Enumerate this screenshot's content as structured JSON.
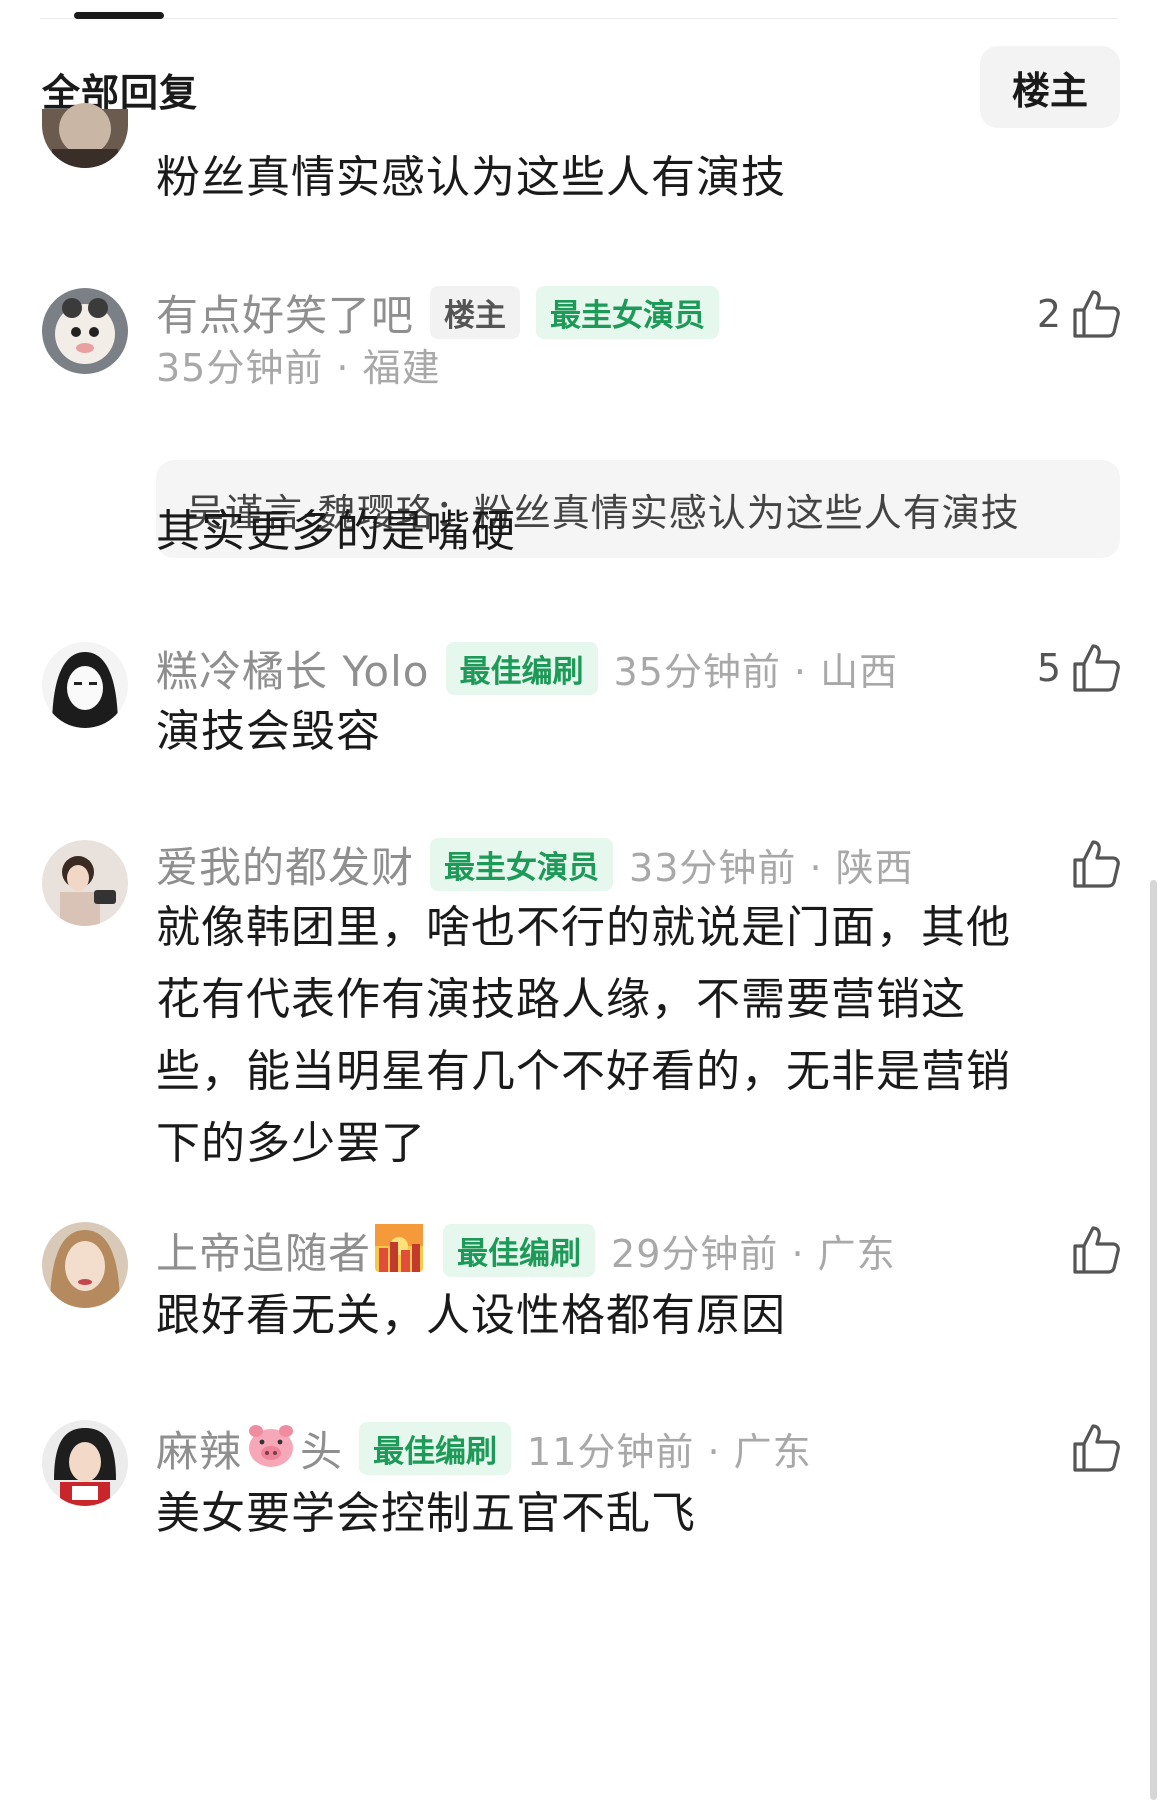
{
  "header": {
    "title": "全部回复",
    "op_filter_label": "楼主"
  },
  "comments": [
    {
      "text": "粉丝真情实感认为这些人有演技"
    },
    {
      "username": "有点好笑了吧",
      "badges": [
        "楼主",
        "最圭女演员"
      ],
      "time_location": "35分钟前 · 福建",
      "likes": "2",
      "quote": "吴谨言-魏璎珞：粉丝真情实感认为这些人有演技",
      "text": "其实更多的是嘴硬"
    },
    {
      "username": "糕冷橘长 Yolo",
      "badges": [
        "最佳编刷"
      ],
      "time_location": "35分钟前 · 山西",
      "likes": "5",
      "text": "演技会毁容"
    },
    {
      "username": "爱我的都发财",
      "badges": [
        "最圭女演员"
      ],
      "time_location": "33分钟前 · 陕西",
      "likes": "",
      "text_lines": [
        "就像韩团里，啥也不行的就说是门面，其他",
        "花有代表作有演技路人缘，不需要营销这",
        "些，能当明星有几个不好看的，无非是营销",
        "下的多少罢了"
      ]
    },
    {
      "username": "上帝追随者",
      "badges": [
        "最佳编刷"
      ],
      "time_location": "29分钟前 · 广东",
      "likes": "",
      "text": "跟好看无关，人设性格都有原因"
    },
    {
      "username_part1": "麻辣",
      "username_part2": "头",
      "badges": [
        "最佳编刷"
      ],
      "time_location": "11分钟前 · 广东",
      "likes": "",
      "text": "美女要学会控制五官不乱飞"
    }
  ],
  "icons": {
    "like": "thumbs-up-icon",
    "emoji_city": "city-sunset-emoji",
    "emoji_pig": "pig-face-emoji"
  },
  "colors": {
    "badge_green_bg": "#e6f7ee",
    "badge_green_text": "#1d9a57",
    "meta_gray": "#8f8f8f"
  }
}
